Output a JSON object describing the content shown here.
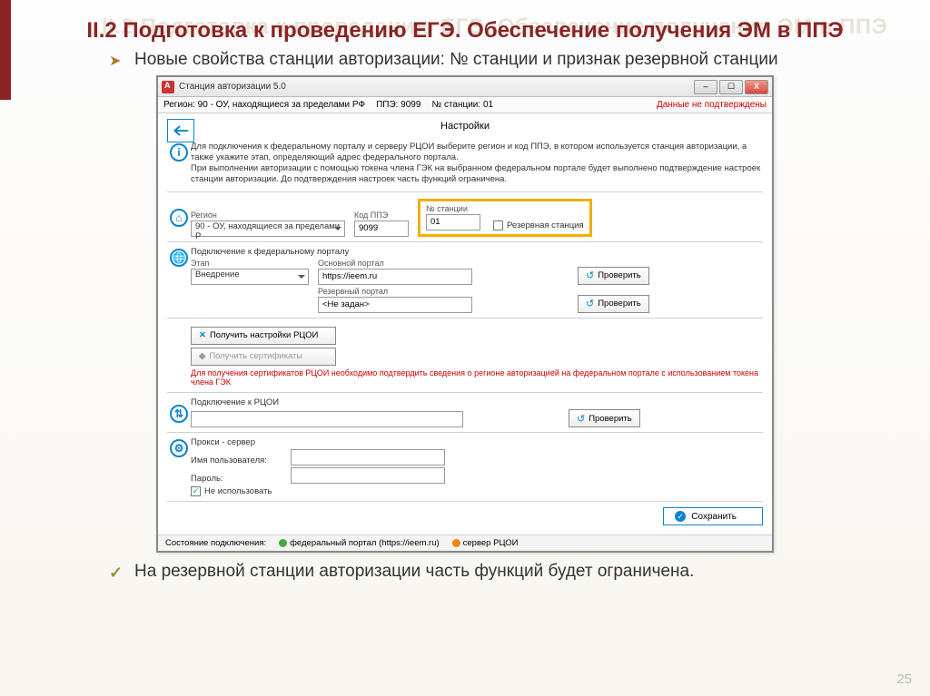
{
  "slide": {
    "ghost_title": "II.2 Подготовка к проведению ЕГЭ. Обеспечение получения ЭМ в ППЭ",
    "title": "II.2 Подготовка к проведению ЕГЭ. Обеспечение получения ЭМ в ППЭ",
    "bullet_top": "Новые свойства станции авторизации: № станции и признак резервной станции",
    "bullet_bottom": "На резервной станции авторизации часть функций будет ограничена.",
    "page_number": "25"
  },
  "app": {
    "window_title": "Станция авторизации 5.0",
    "win_min": "–",
    "win_max": "☐",
    "win_close": "X",
    "info": {
      "region": "Регион: 90 - ОУ, находящиеся за пределами РФ",
      "ppe": "ППЭ: 9099",
      "station": "№ станции: 01",
      "warn": "Данные не подтверждены"
    },
    "header": "Настройки",
    "intro": "Для подключения к федеральному порталу и серверу РЦОИ выберите регион и код ППЭ, в котором используется станция авторизации, а также укажите этап, определяющий адрес федерального портала.\nПри выполнении авторизации с помощью токена члена ГЭК на выбранном федеральном портале будет выполнено подтверждение настроек станции авторизации. До подтверждения настроек часть функций ограничена.",
    "region": {
      "label": "Регион",
      "value": "90 - ОУ, находящиеся за пределами Р"
    },
    "ppe_code": {
      "label": "Код ППЭ",
      "value": "9099"
    },
    "station_no": {
      "label": "№ станции",
      "value": "01"
    },
    "reserve": {
      "label": "Резервная станция"
    },
    "portal": {
      "section": "Подключение к федеральному порталу",
      "stage_label": "Этап",
      "stage_value": "Внедрение",
      "main_label": "Основной портал",
      "main_value": "https://ieem.ru",
      "backup_label": "Резервный портал",
      "backup_value": "<Не задан>",
      "check": "Проверить"
    },
    "rcoi_btns": {
      "get_settings": "Получить настройки РЦОИ",
      "get_certs": "Получить сертификаты",
      "warn": "Для получения сертификатов РЦОИ необходимо подтвердить сведения о регионе авторизацией на федеральном портале с использованием токена члена ГЭК"
    },
    "rcoi": {
      "section": "Подключение к РЦОИ",
      "check": "Проверить"
    },
    "proxy": {
      "section": "Прокси - сервер",
      "user_label": "Имя пользователя:",
      "pass_label": "Пароль:",
      "nouse": "Не использовать"
    },
    "save": "Сохранить",
    "status": {
      "label": "Состояние подключения:",
      "fed": "федеральный портал (https://ieem.ru)",
      "rcoi": "сервер РЦОИ"
    }
  }
}
